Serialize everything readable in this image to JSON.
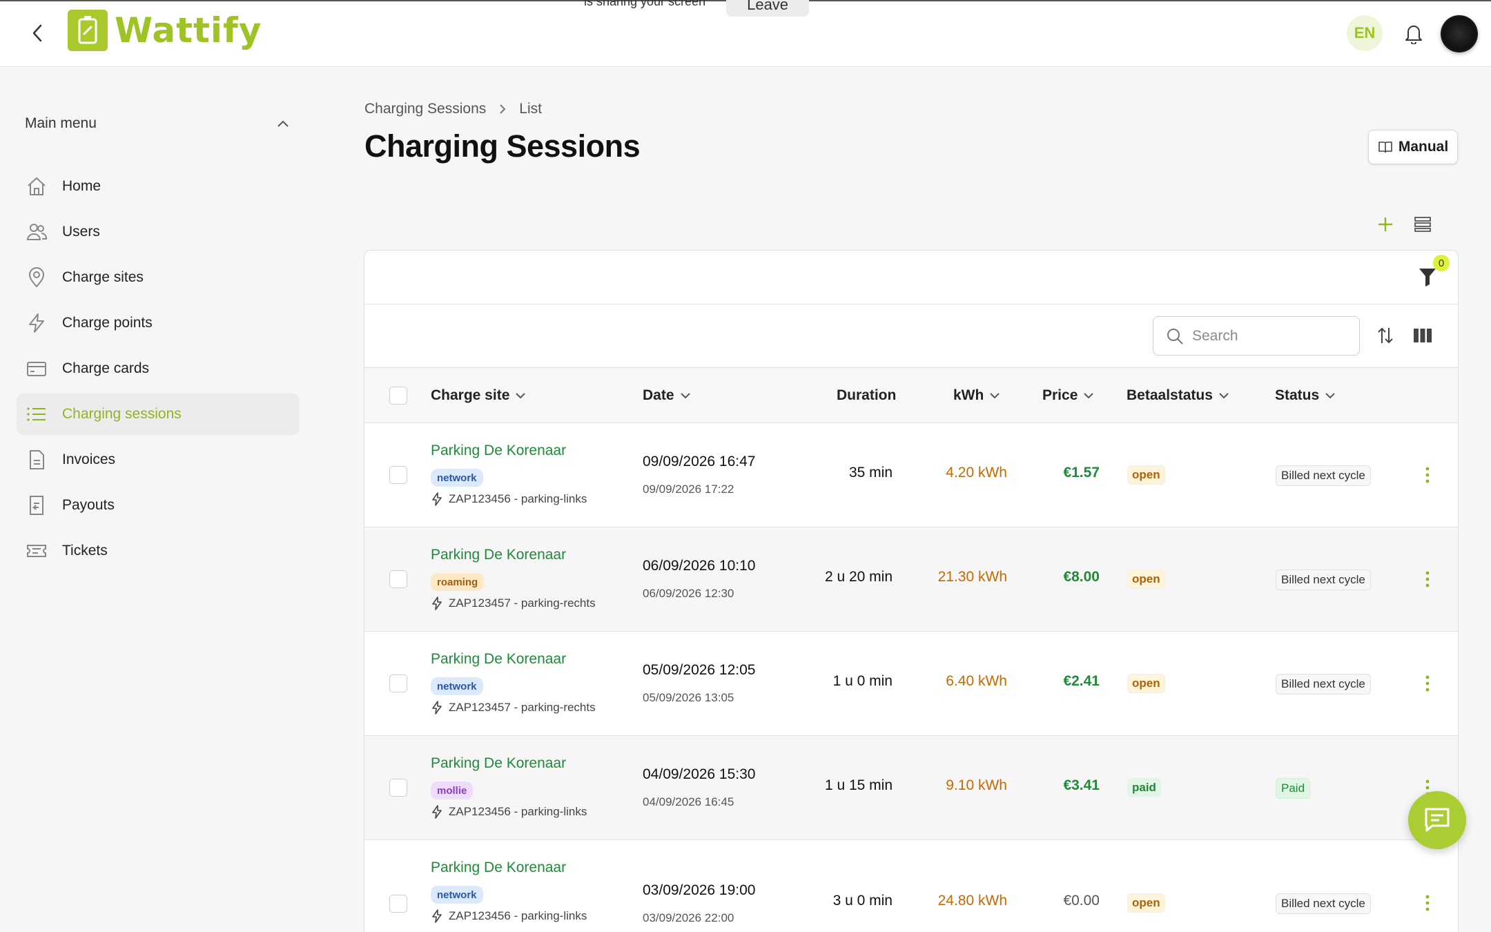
{
  "screen_share": {
    "text": "is sharing your screen",
    "leave_label": "Leave"
  },
  "header": {
    "app_name": "Wattify",
    "language": "EN"
  },
  "sidebar": {
    "menu_title": "Main menu",
    "items": [
      {
        "label": "Home",
        "icon": "home-icon"
      },
      {
        "label": "Users",
        "icon": "users-icon"
      },
      {
        "label": "Charge sites",
        "icon": "map-pin-icon"
      },
      {
        "label": "Charge points",
        "icon": "lightning-icon"
      },
      {
        "label": "Charge cards",
        "icon": "card-icon"
      },
      {
        "label": "Charging sessions",
        "icon": "list-icon",
        "active": true
      },
      {
        "label": "Invoices",
        "icon": "document-icon"
      },
      {
        "label": "Payouts",
        "icon": "payout-icon"
      },
      {
        "label": "Tickets",
        "icon": "ticket-icon"
      }
    ]
  },
  "breadcrumb": {
    "parent": "Charging Sessions",
    "current": "List"
  },
  "page": {
    "title": "Charging Sessions",
    "manual_label": "Manual"
  },
  "filter": {
    "count": "0"
  },
  "search": {
    "placeholder": "Search"
  },
  "table": {
    "columns": {
      "charge_site": "Charge site",
      "date": "Date",
      "duration": "Duration",
      "kwh": "kWh",
      "price": "Price",
      "betaalstatus": "Betaalstatus",
      "status": "Status"
    },
    "rows": [
      {
        "site": "Parking De Korenaar",
        "tag": "network",
        "charge_point": "ZAP123456 - parking-links",
        "start": "09/09/2026 16:47",
        "end": "09/09/2026 17:22",
        "duration": "35 min",
        "kwh": "4.20 kWh",
        "price": "€1.57",
        "payment": "open",
        "status": "Billed next cycle"
      },
      {
        "site": "Parking De Korenaar",
        "tag": "roaming",
        "charge_point": "ZAP123457 - parking-rechts",
        "start": "06/09/2026 10:10",
        "end": "06/09/2026 12:30",
        "duration": "2 u 20 min",
        "kwh": "21.30 kWh",
        "price": "€8.00",
        "payment": "open",
        "status": "Billed next cycle"
      },
      {
        "site": "Parking De Korenaar",
        "tag": "network",
        "charge_point": "ZAP123457 - parking-rechts",
        "start": "05/09/2026 12:05",
        "end": "05/09/2026 13:05",
        "duration": "1 u 0 min",
        "kwh": "6.40 kWh",
        "price": "€2.41",
        "payment": "open",
        "status": "Billed next cycle"
      },
      {
        "site": "Parking De Korenaar",
        "tag": "mollie",
        "charge_point": "ZAP123456 - parking-links",
        "start": "04/09/2026 15:30",
        "end": "04/09/2026 16:45",
        "duration": "1 u 15 min",
        "kwh": "9.10 kWh",
        "price": "€3.41",
        "payment": "paid",
        "status": "Paid"
      },
      {
        "site": "Parking De Korenaar",
        "tag": "network",
        "charge_point": "ZAP123456 - parking-links",
        "start": "03/09/2026 19:00",
        "end": "03/09/2026 22:00",
        "duration": "3 u 0 min",
        "kwh": "24.80 kWh",
        "price": "€0.00",
        "payment": "open",
        "status": "Billed next cycle"
      }
    ]
  },
  "colors": {
    "brand": "#9dc325",
    "link": "#1f8a3a",
    "kwh": "#c46a00"
  }
}
